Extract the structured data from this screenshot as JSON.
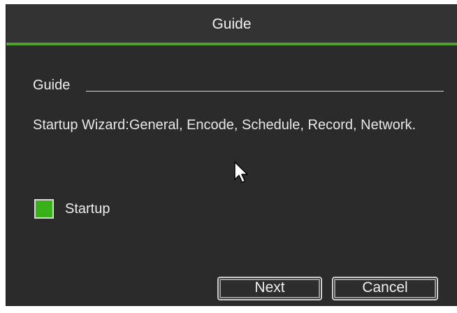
{
  "window": {
    "title": "Guide"
  },
  "section": {
    "label": "Guide"
  },
  "description": "Startup Wizard:General, Encode, Schedule, Record, Network.",
  "startup": {
    "label": "Startup",
    "checked": true
  },
  "buttons": {
    "next": "Next",
    "cancel": "Cancel"
  },
  "colors": {
    "accent": "#4ea12a",
    "checkbox_fill": "#39b21a",
    "background": "#2b2b2b"
  },
  "icons": {
    "cursor": "mouse-pointer-icon"
  }
}
